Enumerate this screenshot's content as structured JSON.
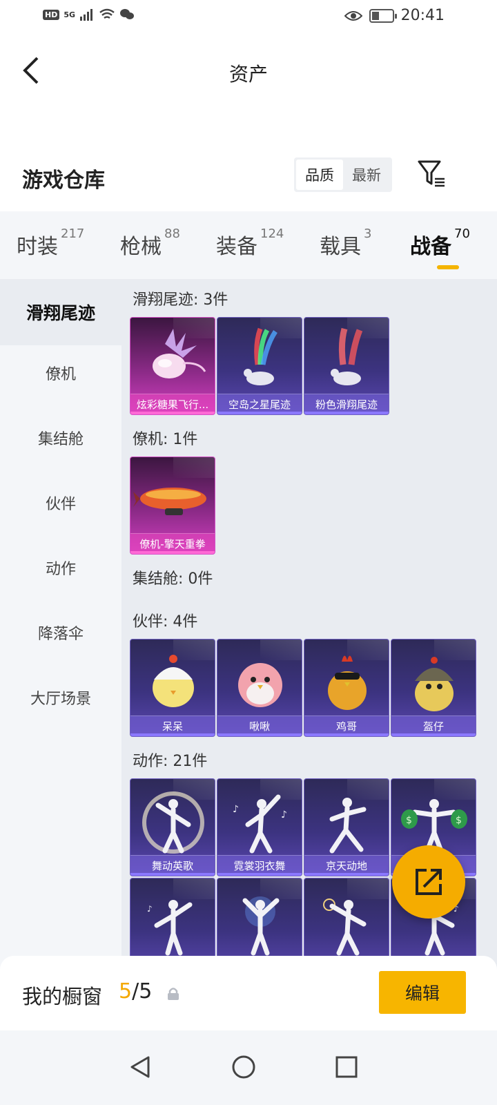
{
  "status_bar": {
    "hd": "HD",
    "network": "5G",
    "time": "20:41"
  },
  "header": {
    "title": "资产"
  },
  "warehouse": {
    "title": "游戏仓库",
    "sort_options": [
      "品质",
      "最新"
    ],
    "active_sort": "品质"
  },
  "tabs": [
    {
      "label": "时装",
      "count": "217"
    },
    {
      "label": "枪械",
      "count": "88"
    },
    {
      "label": "装备",
      "count": "124"
    },
    {
      "label": "载具",
      "count": "3"
    },
    {
      "label": "战备",
      "count": "70"
    }
  ],
  "active_tab": "战备",
  "sidebar": {
    "items": [
      "滑翔尾迹",
      "僚机",
      "集结舱",
      "伙伴",
      "动作",
      "降落伞",
      "大厅场景"
    ],
    "active": "滑翔尾迹"
  },
  "sections": [
    {
      "title": "滑翔尾迹: 3件",
      "items": [
        "炫彩糖果飞行...",
        "空岛之星尾迹",
        "粉色滑翔尾迹"
      ]
    },
    {
      "title": "僚机: 1件",
      "items": [
        "僚机-擎天重拳"
      ]
    },
    {
      "title": "集结舱: 0件",
      "items": []
    },
    {
      "title": "伙伴: 4件",
      "items": [
        "呆呆",
        "啾啾",
        "鸡哥",
        "盔仔"
      ]
    },
    {
      "title": "动作: 21件",
      "items": [
        "舞动英歌",
        "霓裳羽衣舞",
        "京天动地",
        "石"
      ]
    }
  ],
  "showcase": {
    "label": "我的橱窗",
    "current": "5",
    "separator": "/",
    "total": "5",
    "edit_label": "编辑"
  },
  "colors": {
    "accent": "#f5ac00",
    "rare_purple": "#3c3380",
    "legendary_pink": "#d23fc0"
  }
}
